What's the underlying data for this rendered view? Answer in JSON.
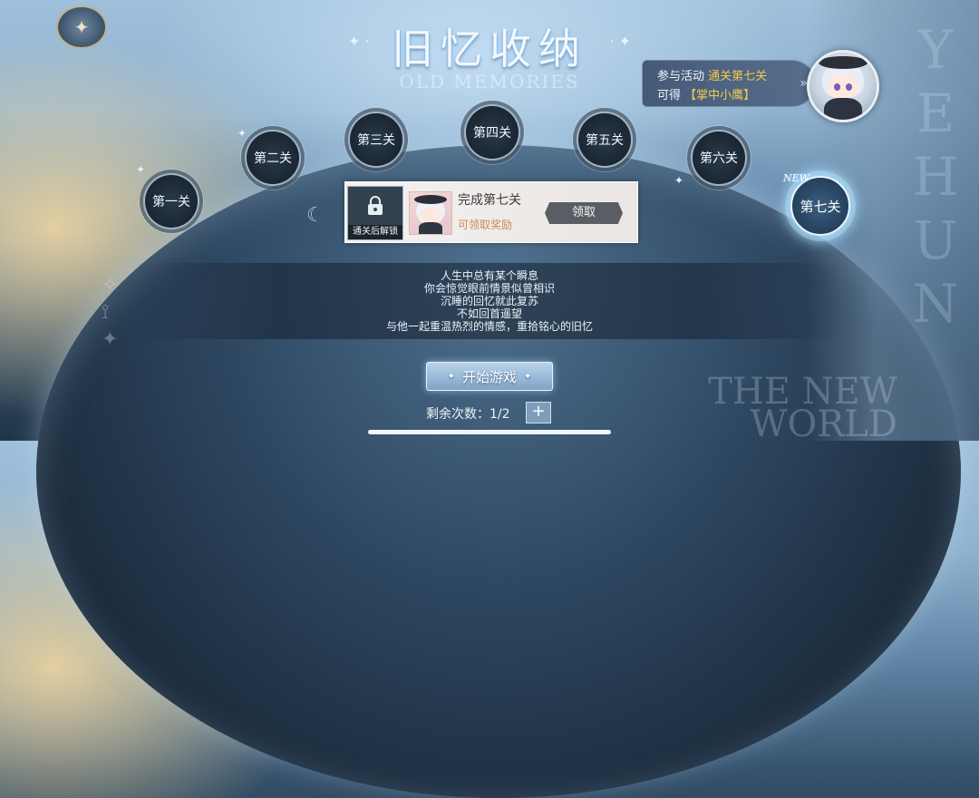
{
  "title": {
    "main": "旧忆收纳",
    "subtitle": "OLD MEMORIES"
  },
  "banner": {
    "line1_prefix": "参与活动",
    "line1_highlight": "通关第七关",
    "line2_prefix": "可得",
    "line2_highlight": "【掌中小鹰】"
  },
  "levels": [
    {
      "label": "第一关"
    },
    {
      "label": "第二关"
    },
    {
      "label": "第三关"
    },
    {
      "label": "第四关"
    },
    {
      "label": "第五关"
    },
    {
      "label": "第六关"
    },
    {
      "label": "第七关",
      "tag": "NEW",
      "active": true
    }
  ],
  "reward_card": {
    "lock_label": "通关后解锁",
    "title": "完成第七关",
    "status": "可领取奖励",
    "claim_label": "领取"
  },
  "description": [
    "人生中总有某个瞬息",
    "你会惊觉眼前情景似曾相识",
    "沉睡的回忆就此复苏",
    "不如回首遥望",
    "与他一起重温热烈的情感，重拾铭心的旧忆"
  ],
  "start_button": {
    "label": "开始游戏"
  },
  "remaining": {
    "label": "剩余次数：",
    "value": "1/2"
  },
  "decor": {
    "vertical_letters": [
      "Y",
      "E",
      "H",
      "U",
      "N"
    ],
    "world_text_1": "THE NEW",
    "world_text_2": "WORLD"
  },
  "colors": {
    "highlight": "#f4c94a",
    "status": "#c88b5a",
    "claim_button": "#5a5e64"
  },
  "icons": {
    "emblem": "compass-emblem-icon",
    "lock": "lock-icon",
    "plus": "plus-icon",
    "arrow": "double-chevron-right-icon"
  }
}
